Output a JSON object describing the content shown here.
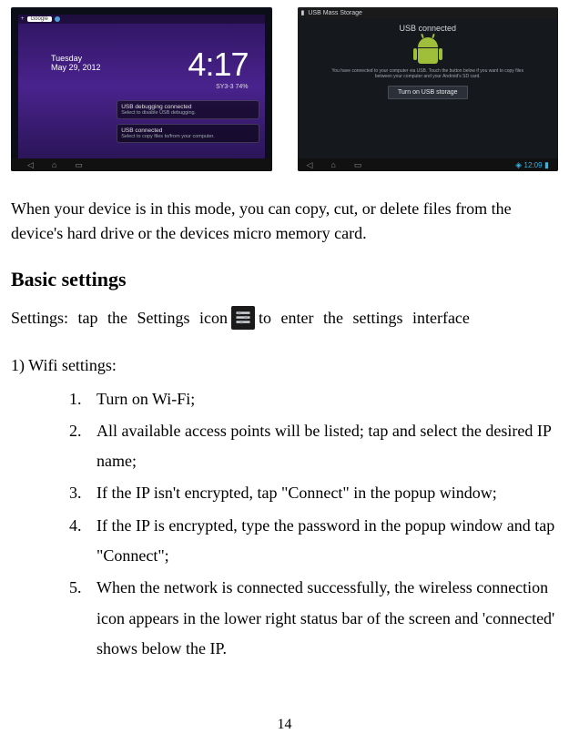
{
  "shot1": {
    "google": "Google",
    "date_line1": "Tuesday",
    "date_line2": "May 29, 2012",
    "time": "4:17",
    "battery": "SY3-3   74%",
    "notif1_title": "USB debugging connected",
    "notif1_sub": "Select to disable USB debugging.",
    "notif2_title": "USB connected",
    "notif2_sub": "Select to copy files to/from your computer."
  },
  "shot2": {
    "tab_title": "USB Mass Storage",
    "body_title": "USB connected",
    "msg": "You have connected to your computer via USB. Touch the button below if you want to copy files between your computer and your Android's SD card.",
    "button": "Turn on USB storage",
    "clock": "12:09"
  },
  "para1": "When your device is in this mode, you can copy, cut, or delete files from the device's hard drive or the devices micro memory card.",
  "heading": "Basic settings",
  "settings_prefix": "Settings: tap the Settings icon",
  "settings_suffix": " to enter the settings interface",
  "wifi_head": "1) Wifi settings:",
  "steps": {
    "s1": "Turn on Wi-Fi;",
    "s2": "All available access points will be listed; tap and select the desired IP name;",
    "s3": "If the IP isn't encrypted, tap \"Connect\" in the popup window;",
    "s4": "If the IP is encrypted, type the password in the popup window and tap \"Connect\";",
    "s5": "When the network is connected successfully, the wireless connection icon appears in the lower right status bar of the screen and 'connected' shows below the IP."
  },
  "page": "14"
}
